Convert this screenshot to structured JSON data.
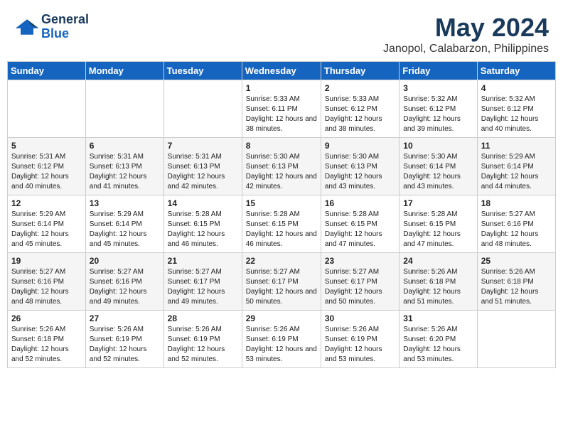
{
  "logo": {
    "name_part1": "General",
    "name_part2": "Blue"
  },
  "title": "May 2024",
  "subtitle": "Janopol, Calabarzon, Philippines",
  "weekdays": [
    "Sunday",
    "Monday",
    "Tuesday",
    "Wednesday",
    "Thursday",
    "Friday",
    "Saturday"
  ],
  "weeks": [
    [
      {
        "day": "",
        "sunrise": "",
        "sunset": "",
        "daylight": ""
      },
      {
        "day": "",
        "sunrise": "",
        "sunset": "",
        "daylight": ""
      },
      {
        "day": "",
        "sunrise": "",
        "sunset": "",
        "daylight": ""
      },
      {
        "day": "1",
        "sunrise": "5:33 AM",
        "sunset": "6:11 PM",
        "daylight": "12 hours and 38 minutes."
      },
      {
        "day": "2",
        "sunrise": "5:33 AM",
        "sunset": "6:12 PM",
        "daylight": "12 hours and 38 minutes."
      },
      {
        "day": "3",
        "sunrise": "5:32 AM",
        "sunset": "6:12 PM",
        "daylight": "12 hours and 39 minutes."
      },
      {
        "day": "4",
        "sunrise": "5:32 AM",
        "sunset": "6:12 PM",
        "daylight": "12 hours and 40 minutes."
      }
    ],
    [
      {
        "day": "5",
        "sunrise": "5:31 AM",
        "sunset": "6:12 PM",
        "daylight": "12 hours and 40 minutes."
      },
      {
        "day": "6",
        "sunrise": "5:31 AM",
        "sunset": "6:13 PM",
        "daylight": "12 hours and 41 minutes."
      },
      {
        "day": "7",
        "sunrise": "5:31 AM",
        "sunset": "6:13 PM",
        "daylight": "12 hours and 42 minutes."
      },
      {
        "day": "8",
        "sunrise": "5:30 AM",
        "sunset": "6:13 PM",
        "daylight": "12 hours and 42 minutes."
      },
      {
        "day": "9",
        "sunrise": "5:30 AM",
        "sunset": "6:13 PM",
        "daylight": "12 hours and 43 minutes."
      },
      {
        "day": "10",
        "sunrise": "5:30 AM",
        "sunset": "6:14 PM",
        "daylight": "12 hours and 43 minutes."
      },
      {
        "day": "11",
        "sunrise": "5:29 AM",
        "sunset": "6:14 PM",
        "daylight": "12 hours and 44 minutes."
      }
    ],
    [
      {
        "day": "12",
        "sunrise": "5:29 AM",
        "sunset": "6:14 PM",
        "daylight": "12 hours and 45 minutes."
      },
      {
        "day": "13",
        "sunrise": "5:29 AM",
        "sunset": "6:14 PM",
        "daylight": "12 hours and 45 minutes."
      },
      {
        "day": "14",
        "sunrise": "5:28 AM",
        "sunset": "6:15 PM",
        "daylight": "12 hours and 46 minutes."
      },
      {
        "day": "15",
        "sunrise": "5:28 AM",
        "sunset": "6:15 PM",
        "daylight": "12 hours and 46 minutes."
      },
      {
        "day": "16",
        "sunrise": "5:28 AM",
        "sunset": "6:15 PM",
        "daylight": "12 hours and 47 minutes."
      },
      {
        "day": "17",
        "sunrise": "5:28 AM",
        "sunset": "6:15 PM",
        "daylight": "12 hours and 47 minutes."
      },
      {
        "day": "18",
        "sunrise": "5:27 AM",
        "sunset": "6:16 PM",
        "daylight": "12 hours and 48 minutes."
      }
    ],
    [
      {
        "day": "19",
        "sunrise": "5:27 AM",
        "sunset": "6:16 PM",
        "daylight": "12 hours and 48 minutes."
      },
      {
        "day": "20",
        "sunrise": "5:27 AM",
        "sunset": "6:16 PM",
        "daylight": "12 hours and 49 minutes."
      },
      {
        "day": "21",
        "sunrise": "5:27 AM",
        "sunset": "6:17 PM",
        "daylight": "12 hours and 49 minutes."
      },
      {
        "day": "22",
        "sunrise": "5:27 AM",
        "sunset": "6:17 PM",
        "daylight": "12 hours and 50 minutes."
      },
      {
        "day": "23",
        "sunrise": "5:27 AM",
        "sunset": "6:17 PM",
        "daylight": "12 hours and 50 minutes."
      },
      {
        "day": "24",
        "sunrise": "5:26 AM",
        "sunset": "6:18 PM",
        "daylight": "12 hours and 51 minutes."
      },
      {
        "day": "25",
        "sunrise": "5:26 AM",
        "sunset": "6:18 PM",
        "daylight": "12 hours and 51 minutes."
      }
    ],
    [
      {
        "day": "26",
        "sunrise": "5:26 AM",
        "sunset": "6:18 PM",
        "daylight": "12 hours and 52 minutes."
      },
      {
        "day": "27",
        "sunrise": "5:26 AM",
        "sunset": "6:19 PM",
        "daylight": "12 hours and 52 minutes."
      },
      {
        "day": "28",
        "sunrise": "5:26 AM",
        "sunset": "6:19 PM",
        "daylight": "12 hours and 52 minutes."
      },
      {
        "day": "29",
        "sunrise": "5:26 AM",
        "sunset": "6:19 PM",
        "daylight": "12 hours and 53 minutes."
      },
      {
        "day": "30",
        "sunrise": "5:26 AM",
        "sunset": "6:19 PM",
        "daylight": "12 hours and 53 minutes."
      },
      {
        "day": "31",
        "sunrise": "5:26 AM",
        "sunset": "6:20 PM",
        "daylight": "12 hours and 53 minutes."
      },
      {
        "day": "",
        "sunrise": "",
        "sunset": "",
        "daylight": ""
      }
    ]
  ]
}
